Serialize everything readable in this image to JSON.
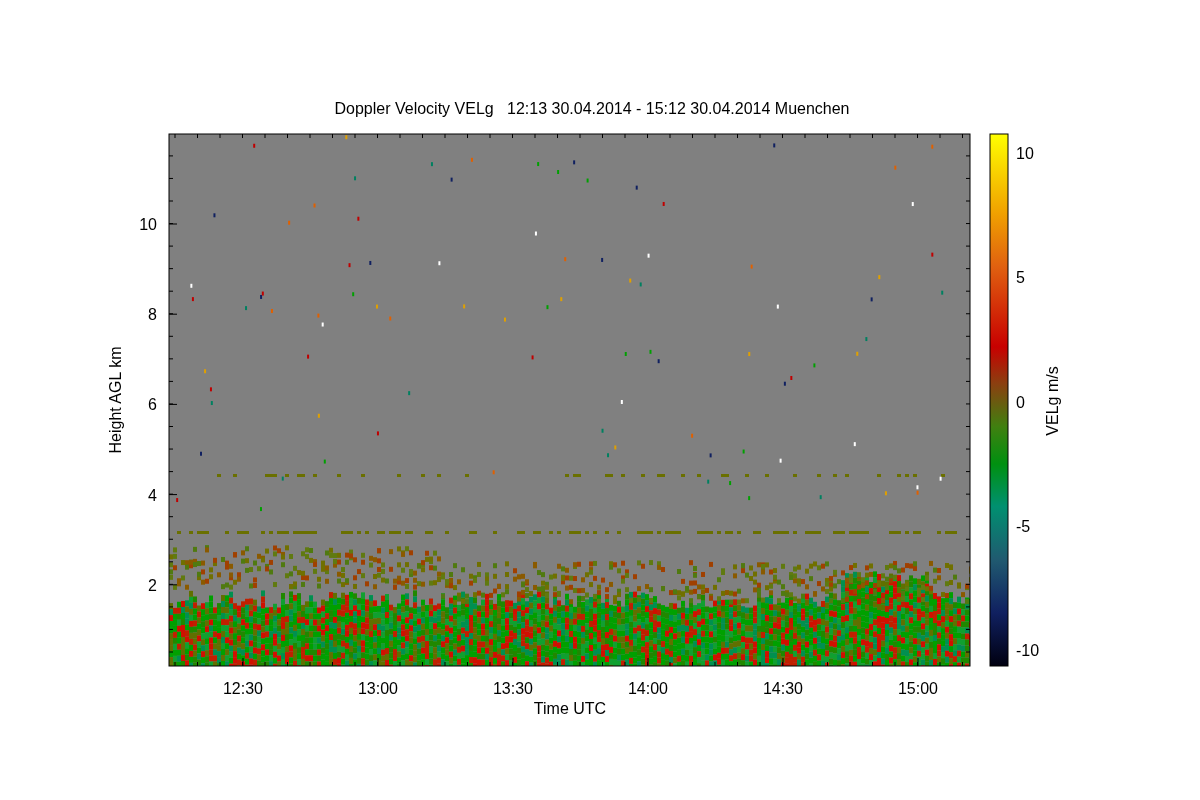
{
  "plot": {
    "title": "Doppler Velocity VELg   12:13 30.04.2014 - 15:12 30.04.2014 Muenchen",
    "ylabel": "Height AGL km",
    "xlabel": "Time UTC",
    "xtick_labels": [
      "12:30",
      "13:00",
      "13:30",
      "14:00",
      "14:30",
      "15:00"
    ],
    "ytick_labels": [
      "10",
      "8",
      "6",
      "4",
      "2"
    ]
  },
  "colorbar": {
    "label": "VELg m/s",
    "tick_labels": [
      "10",
      "5",
      "0",
      "-5",
      "-10"
    ]
  }
}
